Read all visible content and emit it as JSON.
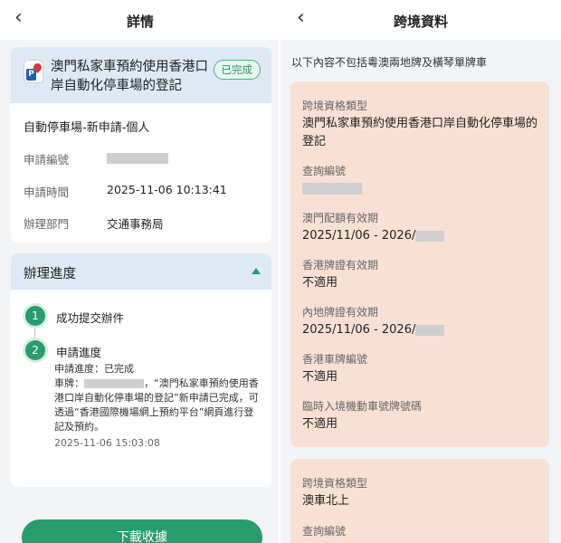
{
  "left": {
    "header": {
      "back_glyph": "‹",
      "title": "詳情"
    },
    "summary": {
      "service_name": "澳門私家車預約使用香港口岸自動化停車場的登記",
      "status_badge": "已完成",
      "type_line": "自動停車場-新申請-個人",
      "fields": [
        {
          "label": "申請編號",
          "value": ""
        },
        {
          "label": "申請時間",
          "value": "2025-11-06 10:13:41"
        },
        {
          "label": "辦理部門",
          "value": "交通事務局"
        }
      ]
    },
    "progress": {
      "title": "辦理進度",
      "steps": [
        {
          "num": "1",
          "label": "成功提交辦件"
        },
        {
          "num": "2",
          "label": "申請進度"
        }
      ],
      "step2_status": "申請進度：已完成",
      "step2_plate_prefix": "車牌：",
      "step2_message": "，“澳門私家車預約使用香港口岸自動化停車場的登記”新申請已完成，可透過“香港國際機場網上預約平台”網頁進行登記及預約。",
      "step2_time": "2025-11-06 15:03:08"
    },
    "download_button": "下載收據"
  },
  "right": {
    "header": {
      "back_glyph": "‹",
      "title": "跨境資料"
    },
    "note": "以下內容不包括粵澳兩地牌及橫琴單牌車",
    "card1": {
      "fields": [
        {
          "label": "跨境資格類型",
          "value": "澳門私家車預約使用香港口岸自動化停車場的登記"
        },
        {
          "label": "查詢編號",
          "value": ""
        },
        {
          "label": "澳門配額有效期",
          "value": "2025/11/06 - 2026/"
        },
        {
          "label": "香港牌證有效期",
          "value": "不適用"
        },
        {
          "label": "內地牌證有效期",
          "value": "2025/11/06 - 2026/"
        },
        {
          "label": "香港車牌編號",
          "value": "不適用"
        },
        {
          "label": "臨時入境機動車號牌號碼",
          "value": "不適用"
        }
      ]
    },
    "card2": {
      "fields": [
        {
          "label": "跨境資格類型",
          "value": "澳車北上"
        },
        {
          "label": "查詢編號",
          "value": ""
        }
      ]
    }
  }
}
